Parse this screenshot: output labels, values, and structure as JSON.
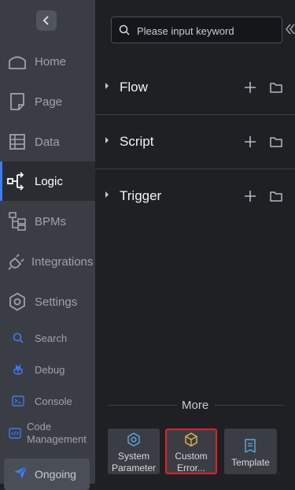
{
  "sidebar": {
    "nav": [
      {
        "label": "Home",
        "icon": "home-icon"
      },
      {
        "label": "Page",
        "icon": "page-icon"
      },
      {
        "label": "Data",
        "icon": "data-table-icon"
      },
      {
        "label": "Logic",
        "icon": "logic-flow-icon",
        "active": true
      },
      {
        "label": "BPMs",
        "icon": "bpms-tree-icon"
      },
      {
        "label": "Integrations",
        "icon": "plug-icon"
      },
      {
        "label": "Settings",
        "icon": "gear-icon"
      }
    ],
    "tools": [
      {
        "label": "Search",
        "icon": "search-icon"
      },
      {
        "label": "Debug",
        "icon": "debug-icon"
      },
      {
        "label": "Console",
        "icon": "console-icon"
      },
      {
        "label_line1": "Code",
        "label_line2": "Management",
        "icon": "code-icon"
      }
    ],
    "ongoing": {
      "label": "Ongoing",
      "icon": "send-icon"
    }
  },
  "search": {
    "placeholder": "Please input keyword"
  },
  "sections": [
    {
      "title": "Flow"
    },
    {
      "title": "Script"
    },
    {
      "title": "Trigger"
    }
  ],
  "more": {
    "label": "More",
    "cards": [
      {
        "line1": "System",
        "line2": "Parameter",
        "icon": "gear-outline-icon"
      },
      {
        "line1": "Custom",
        "line2": "Error...",
        "icon": "cube-icon",
        "highlighted": true
      },
      {
        "line1": "Template",
        "line2": "",
        "icon": "document-icon"
      }
    ]
  },
  "colors": {
    "accent": "#3b7cf2",
    "highlight_border": "#e4202a",
    "card_icon": "#5aa9e6",
    "card_icon_highlight": "#e0b84a"
  }
}
